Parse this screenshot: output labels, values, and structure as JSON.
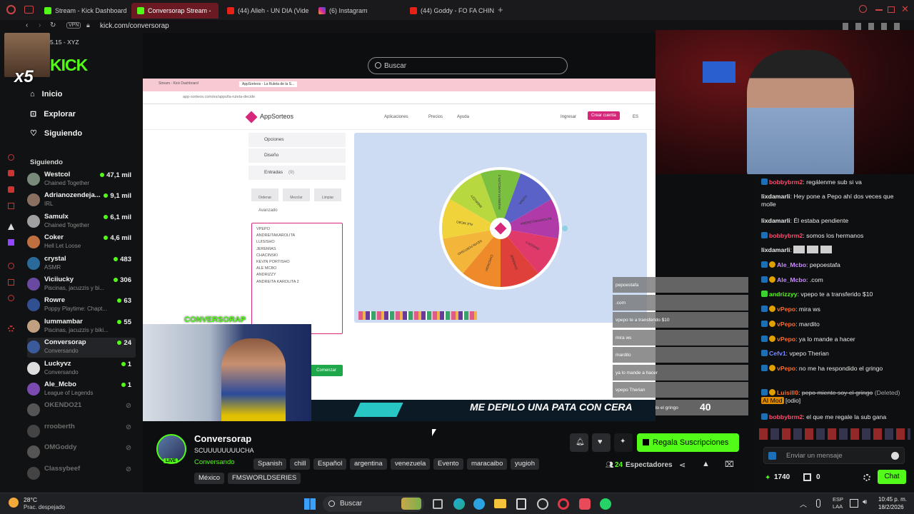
{
  "browser": {
    "tabs": [
      {
        "label": "Stream - Kick Dashboard",
        "active": false
      },
      {
        "label": "Conversorap Stream -",
        "active": true
      },
      {
        "label": "(44) Alleh - UN DIA (Vide",
        "active": false
      },
      {
        "label": "(6) Instagram",
        "active": false
      },
      {
        "label": "(44) Goddy - FO FA CHIN",
        "active": false
      }
    ],
    "address": "kick.com/conversorap",
    "vpn_label": "VPN"
  },
  "overlay": {
    "xyz_text": "5.15 - XYZ",
    "multiplier": "x5"
  },
  "kick": {
    "logo": "KICK",
    "search_placeholder": "Buscar",
    "nav": [
      {
        "label": "Inicio",
        "icon": "home-icon"
      },
      {
        "label": "Explorar",
        "icon": "compass-icon"
      },
      {
        "label": "Siguiendo",
        "icon": "heart-icon"
      }
    ],
    "following_heading": "Siguiendo",
    "following": [
      {
        "name": "Westcol",
        "category": "Chained Together",
        "viewers": "47,1 mil",
        "live": true
      },
      {
        "name": "Adrianozendeja...",
        "category": "IRL",
        "viewers": "9,1 mil",
        "live": true
      },
      {
        "name": "Samulx",
        "category": "Chained Together",
        "viewers": "6,1 mil",
        "live": true
      },
      {
        "name": "Coker",
        "category": "Hell Let Loose",
        "viewers": "4,6 mil",
        "live": true
      },
      {
        "name": "crystal",
        "category": "ASMR",
        "viewers": "483",
        "live": true
      },
      {
        "name": "Viciiucky",
        "category": "Piscinas, jacuzzis y bi...",
        "viewers": "306",
        "live": true
      },
      {
        "name": "Rowre",
        "category": "Poppy Playtime: Chapt...",
        "viewers": "63",
        "live": true
      },
      {
        "name": "lummambar",
        "category": "Piscinas, jacuzzis y biki...",
        "viewers": "55",
        "live": true
      },
      {
        "name": "Conversorap",
        "category": "Conversando",
        "viewers": "24",
        "live": true
      },
      {
        "name": "Luckyvz",
        "category": "Conversando",
        "viewers": "1",
        "live": true
      },
      {
        "name": "Ale_Mcbo",
        "category": "League of Legends",
        "viewers": "1",
        "live": true
      },
      {
        "name": "OKENDO21",
        "category": "",
        "viewers": "",
        "live": false
      },
      {
        "name": "rrooberth",
        "category": "",
        "viewers": "",
        "live": false
      },
      {
        "name": "OMGoddy",
        "category": "",
        "viewers": "",
        "live": false
      },
      {
        "name": "Classybeef",
        "category": "",
        "viewers": "",
        "live": false
      }
    ]
  },
  "stream_content": {
    "inner_tabs": [
      "Stream - Kick Dashboard",
      "AppSorteos - La Ruleta de la S..."
    ],
    "inner_url": "app-sorteos.com/es/apps/la-ruleta-decide",
    "app_name": "AppSorteos",
    "app_menu": [
      "Aplicaciones",
      "Precios",
      "Ayuda"
    ],
    "login": "Ingresar",
    "create": "Crear cuenta",
    "lang": "ES",
    "panel_opciones": "Opciones",
    "panel_diseno": "Diseño",
    "panel_entradas": "Entradas",
    "entradas_count": "(9)",
    "panel_buttons": [
      "Ordenar",
      "Mezclar",
      "Limpiar"
    ],
    "avanzado": "Avanzado",
    "entries": [
      "VPEPO",
      "ANDREITAKAROLITA",
      "LUISISHO",
      "JEREMIAS",
      "CHACINSKI",
      "KEVIN PORTISHO",
      "ALE MCBO",
      "ANDRIZZY",
      "ANDREITA KAROLITA 2"
    ],
    "wheel_labels": [
      "ANDREITA KAROLITA 2",
      "VPEPO",
      "ANDREITAKAROLITA",
      "LUISISHO",
      "JEREMIAS",
      "CHACINSKI",
      "KEVIN PORTISHO",
      "ALE MCBO",
      "ANDRIZZY"
    ],
    "start_button": "Comenzar",
    "webcam_label": "CONVERSORAP",
    "overlay_chat": [
      "pepoestafa",
      ".com",
      "vpepo te a transferido $10",
      "mira ws",
      "mardito",
      "ya lo mande a hacer",
      "vpepo Therian",
      "no me ha respondido el gringo"
    ],
    "caption": "ME DEPILO UNA PATA CON CERA",
    "caption_num": "40"
  },
  "channel": {
    "name": "Conversorap",
    "title": "SCUUUUUUUUCHA",
    "live_badge": "LIVE",
    "category": "Conversando",
    "tags": [
      "Spanish",
      "chill",
      "Español",
      "argentina",
      "venezuela",
      "Evento",
      "maracaibo",
      "yugioh",
      "México",
      "FMSWORLDSERIES"
    ],
    "subscribe_label": "Regala Suscripciones",
    "viewers": "24",
    "viewers_label": "Espectadores"
  },
  "chat": {
    "messages": [
      {
        "user": "bobbybrm2",
        "text": "regálenme sub si va",
        "color": "#ff4d6d"
      },
      {
        "user": "lixdamarli",
        "text": "Hey pone a Pepo ahí dos veces que molle",
        "color": "#e8e8e8"
      },
      {
        "user": "lixdamarli",
        "text": "Él estaba pendiente",
        "color": "#e8e8e8"
      },
      {
        "user": "bobbybrm2",
        "text": "somos los hermanos",
        "color": "#ff4d6d"
      },
      {
        "user": "lixdamarli",
        "text": "",
        "color": "#e8e8e8"
      },
      {
        "user": "Ale_Mcbo",
        "text": "pepoestafa",
        "color": "#c78bff"
      },
      {
        "user": "Ale_Mcbo",
        "text": ".com",
        "color": "#c78bff"
      },
      {
        "user": "andrizzyy",
        "text": "vpepo te a transferido $10",
        "color": "#53fc18"
      },
      {
        "user": "vPepo",
        "text": "mira ws",
        "color": "#ff6b2d"
      },
      {
        "user": "vPepo",
        "text": "mardito",
        "color": "#ff6b2d"
      },
      {
        "user": "vPepo",
        "text": "ya lo mande a hacer",
        "color": "#ff6b2d"
      },
      {
        "user": "Cefv1",
        "text": "vpepo Therian",
        "color": "#7a8cff"
      },
      {
        "user": "vPepo",
        "text": "no me ha respondido el gringo",
        "color": "#ff6b2d"
      },
      {
        "user": "Luisill0",
        "text": "pepo miente soy el gringo",
        "deleted": "(Deleted)",
        "mod_badge": "AI Mod",
        "mod_note": "[odio]",
        "color": "#ff6b2d"
      },
      {
        "user": "bobbybrm2",
        "text": "el que me regale la sub gana",
        "color": "#ff4d6d"
      }
    ],
    "input_placeholder": "Enviar un mensaje",
    "points": "1740",
    "gifts": "0",
    "send_label": "Chat"
  },
  "taskbar": {
    "weather_temp": "28°C",
    "weather_desc": "Prac. despejado",
    "search_label": "Buscar",
    "lang_top": "ESP",
    "lang_bottom": "LAA",
    "time": "10:45 p. m.",
    "date": "18/2/2026"
  },
  "colors": {
    "kick_green": "#53fc18",
    "tab_active": "#6b1a24",
    "appsorteos_pink": "#d6277b"
  }
}
